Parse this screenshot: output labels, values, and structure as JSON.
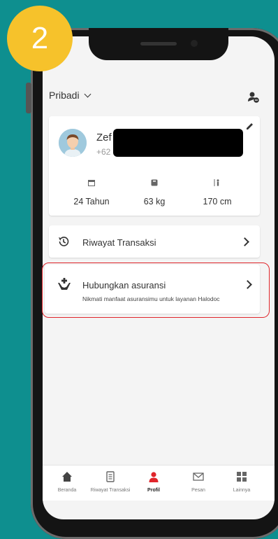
{
  "step_badge": "2",
  "header": {
    "section_label": "Pribadi"
  },
  "profile": {
    "name": "Zef",
    "phone": "+62",
    "stats": [
      {
        "icon": "calendar-icon",
        "value": "24 Tahun"
      },
      {
        "icon": "scale-icon",
        "value": "63 kg"
      },
      {
        "icon": "person-height-icon",
        "value": "170 cm"
      }
    ]
  },
  "menu": {
    "transactions": {
      "label": "Riwayat Transaksi",
      "icon": "history-icon"
    },
    "insurance": {
      "label": "Hubungkan asuransi",
      "subtitle": "Nikmati manfaat asuransimu untuk layanan Halodoc",
      "icon": "insurance-hands-icon"
    }
  },
  "bottom_nav": [
    {
      "label": "Beranda",
      "icon": "home-icon",
      "active": false
    },
    {
      "label": "Riwayat Transaksi",
      "icon": "document-icon",
      "active": false
    },
    {
      "label": "Profil",
      "icon": "profile-icon",
      "active": true
    },
    {
      "label": "Pesan",
      "icon": "mail-icon",
      "active": false
    },
    {
      "label": "Lainnya",
      "icon": "grid-icon",
      "active": false
    }
  ],
  "colors": {
    "background": "#0e8f8f",
    "badge": "#f6c22b",
    "accent": "#e0252b",
    "highlight": "#e0252b"
  }
}
